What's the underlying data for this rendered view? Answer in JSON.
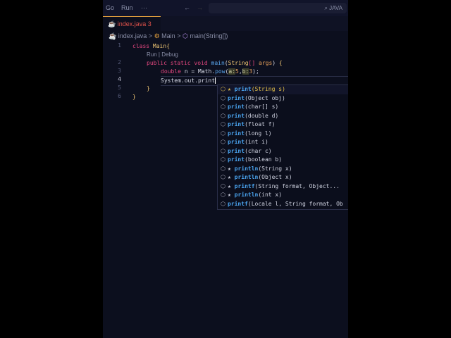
{
  "menu": [
    "Go",
    "Run",
    "···"
  ],
  "search": "⌕ JAVA",
  "tab": {
    "name": "index.java",
    "problems": "3"
  },
  "breadcrumb": [
    "index.java",
    ">",
    "Main",
    ">",
    "main(String[])"
  ],
  "codelens": "Run | Debug",
  "lines": [
    "1",
    "2",
    "3",
    "4",
    "5",
    "6"
  ],
  "suggestions": [
    {
      "star": true,
      "name": "print",
      "args": "(String s)"
    },
    {
      "star": false,
      "name": "print",
      "args": "(Object obj)"
    },
    {
      "star": false,
      "name": "print",
      "args": "(char[] s)"
    },
    {
      "star": false,
      "name": "print",
      "args": "(double d)"
    },
    {
      "star": false,
      "name": "print",
      "args": "(float f)"
    },
    {
      "star": false,
      "name": "print",
      "args": "(long l)"
    },
    {
      "star": false,
      "name": "print",
      "args": "(int i)"
    },
    {
      "star": false,
      "name": "print",
      "args": "(char c)"
    },
    {
      "star": false,
      "name": "print",
      "args": "(boolean b)"
    },
    {
      "star": true,
      "name": "println",
      "args": "(String x)"
    },
    {
      "star": true,
      "name": "println",
      "args": "(Object x)"
    },
    {
      "star": true,
      "name": "printf",
      "args": "(String format, Object..."
    },
    {
      "star": true,
      "name": "println",
      "args": "(int x)"
    },
    {
      "star": false,
      "name": "printf",
      "args": "(Locale l, String format, Ob"
    }
  ]
}
